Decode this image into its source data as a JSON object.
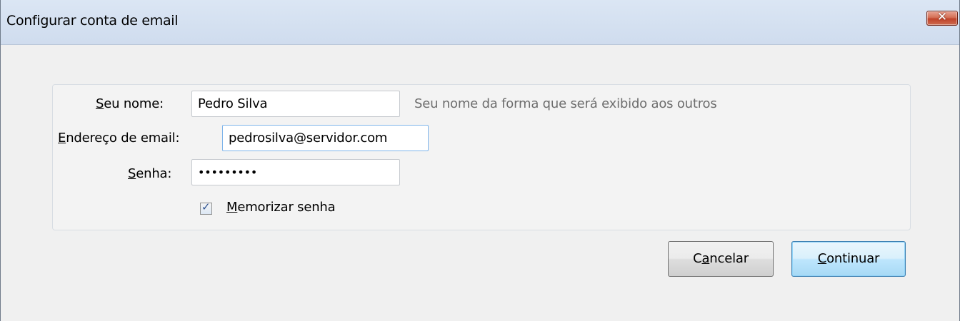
{
  "window": {
    "title": "Configurar conta de email",
    "close_icon": "close-icon"
  },
  "form": {
    "name": {
      "label_mnemonic": "S",
      "label_rest": "eu nome:",
      "value": "Pedro Silva",
      "hint": "Seu nome da forma que será exibido aos outros"
    },
    "email": {
      "label_mnemonic": "E",
      "label_rest": "ndereço de email:",
      "value": "pedrosilva@servidor.com"
    },
    "password": {
      "label_mnemonic": "S",
      "label_rest": "enha:",
      "value": "•••••••••"
    },
    "remember": {
      "checked": true,
      "label_mnemonic": "M",
      "label_rest": "emorizar senha"
    }
  },
  "buttons": {
    "cancel": {
      "pre": "C",
      "mnemonic": "a",
      "post": "ncelar"
    },
    "continue": {
      "pre": "",
      "mnemonic": "C",
      "post": "ontinuar"
    }
  },
  "colors": {
    "accent_focus": "#7eb4ea",
    "close_red": "#c0432a",
    "hint_gray": "#6d6d6d"
  }
}
